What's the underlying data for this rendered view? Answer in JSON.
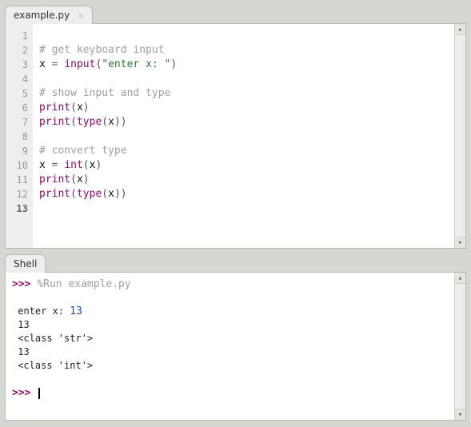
{
  "editor": {
    "tab_label": "example.py",
    "lines": [
      {
        "n": 1,
        "tokens": []
      },
      {
        "n": 2,
        "tokens": [
          {
            "t": "# get keyboard input",
            "c": "c-comment"
          }
        ]
      },
      {
        "n": 3,
        "tokens": [
          {
            "t": "x ",
            "c": "c-ident"
          },
          {
            "t": "=",
            "c": "c-op"
          },
          {
            "t": " ",
            "c": "c-ident"
          },
          {
            "t": "input",
            "c": "c-func"
          },
          {
            "t": "(",
            "c": "c-paren"
          },
          {
            "t": "\"enter x: \"",
            "c": "c-str"
          },
          {
            "t": ")",
            "c": "c-paren"
          }
        ]
      },
      {
        "n": 4,
        "tokens": []
      },
      {
        "n": 5,
        "tokens": [
          {
            "t": "# show input and type",
            "c": "c-comment"
          }
        ]
      },
      {
        "n": 6,
        "tokens": [
          {
            "t": "print",
            "c": "c-func"
          },
          {
            "t": "(",
            "c": "c-paren"
          },
          {
            "t": "x",
            "c": "c-ident"
          },
          {
            "t": ")",
            "c": "c-paren"
          }
        ]
      },
      {
        "n": 7,
        "tokens": [
          {
            "t": "print",
            "c": "c-func"
          },
          {
            "t": "(",
            "c": "c-paren"
          },
          {
            "t": "type",
            "c": "c-func"
          },
          {
            "t": "(",
            "c": "c-paren"
          },
          {
            "t": "x",
            "c": "c-ident"
          },
          {
            "t": "))",
            "c": "c-paren"
          }
        ]
      },
      {
        "n": 8,
        "tokens": []
      },
      {
        "n": 9,
        "tokens": [
          {
            "t": "# convert type",
            "c": "c-comment"
          }
        ]
      },
      {
        "n": 10,
        "tokens": [
          {
            "t": "x ",
            "c": "c-ident"
          },
          {
            "t": "=",
            "c": "c-op"
          },
          {
            "t": " ",
            "c": "c-ident"
          },
          {
            "t": "int",
            "c": "c-func"
          },
          {
            "t": "(",
            "c": "c-paren"
          },
          {
            "t": "x",
            "c": "c-ident"
          },
          {
            "t": ")",
            "c": "c-paren"
          }
        ]
      },
      {
        "n": 11,
        "tokens": [
          {
            "t": "print",
            "c": "c-func"
          },
          {
            "t": "(",
            "c": "c-paren"
          },
          {
            "t": "x",
            "c": "c-ident"
          },
          {
            "t": ")",
            "c": "c-paren"
          }
        ]
      },
      {
        "n": 12,
        "tokens": [
          {
            "t": "print",
            "c": "c-func"
          },
          {
            "t": "(",
            "c": "c-paren"
          },
          {
            "t": "type",
            "c": "c-func"
          },
          {
            "t": "(",
            "c": "c-paren"
          },
          {
            "t": "x",
            "c": "c-ident"
          },
          {
            "t": "))",
            "c": "c-paren"
          }
        ]
      },
      {
        "n": 13,
        "tokens": [],
        "current": true
      }
    ]
  },
  "shell": {
    "tab_label": "Shell",
    "prompt": ">>>",
    "run_command": "%Run example.py",
    "output": [
      {
        "pre": " enter x: ",
        "input": "13"
      },
      {
        "pre": " 13"
      },
      {
        "pre": " <class 'str'>"
      },
      {
        "pre": " 13"
      },
      {
        "pre": " <class 'int'>"
      }
    ]
  }
}
